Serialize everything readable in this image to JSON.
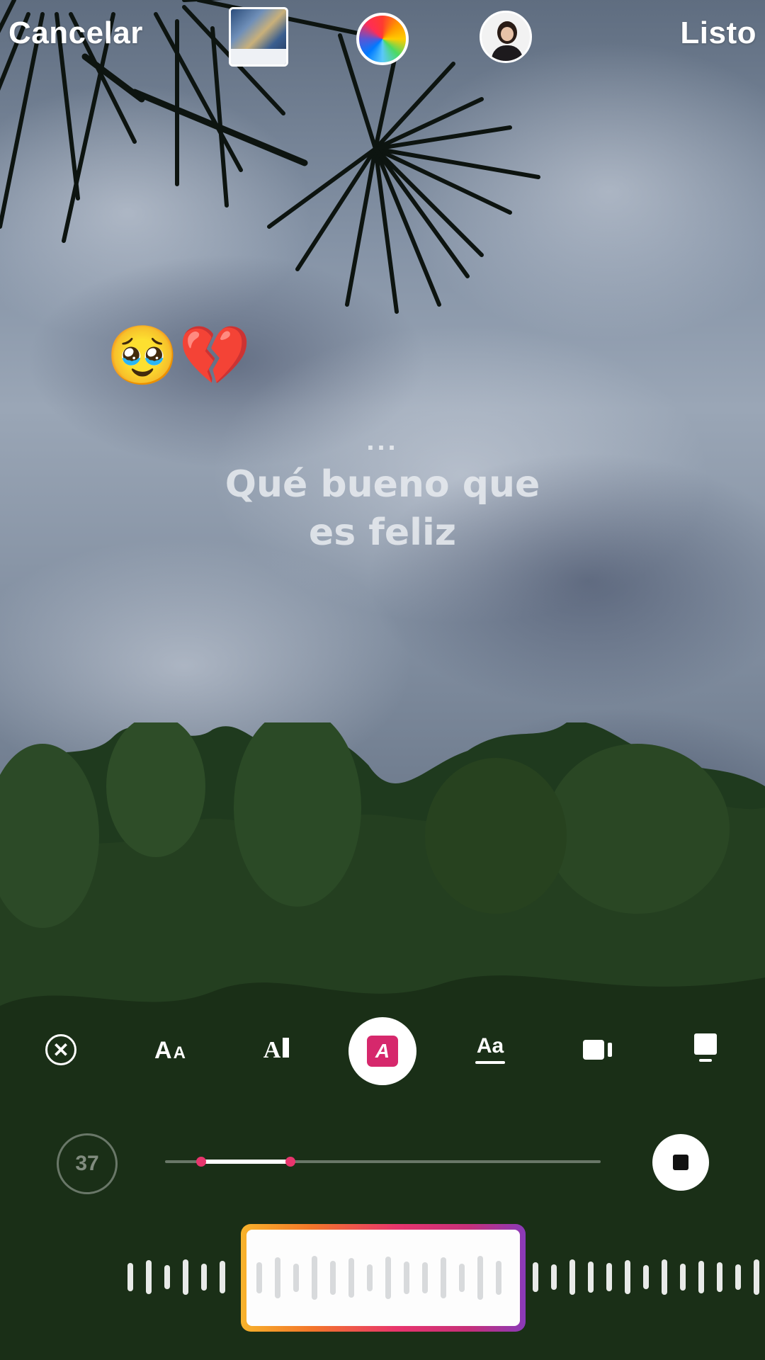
{
  "topbar": {
    "cancel_label": "Cancelar",
    "done_label": "Listo"
  },
  "stickers": {
    "emoji_1": "🥹",
    "emoji_2": "💔"
  },
  "lyrics": {
    "dots": "...",
    "line_1": "Qué bueno que",
    "line_2": "es feliz"
  },
  "music_controls": {
    "duration_label": "37",
    "accent_color": "#e8356d"
  },
  "colors": {
    "selected_style_accent": "#d6286c",
    "waveform_gradient": [
      "#f7b32b",
      "#f3762a",
      "#e8356d",
      "#c6307a",
      "#8a3ab9"
    ]
  }
}
